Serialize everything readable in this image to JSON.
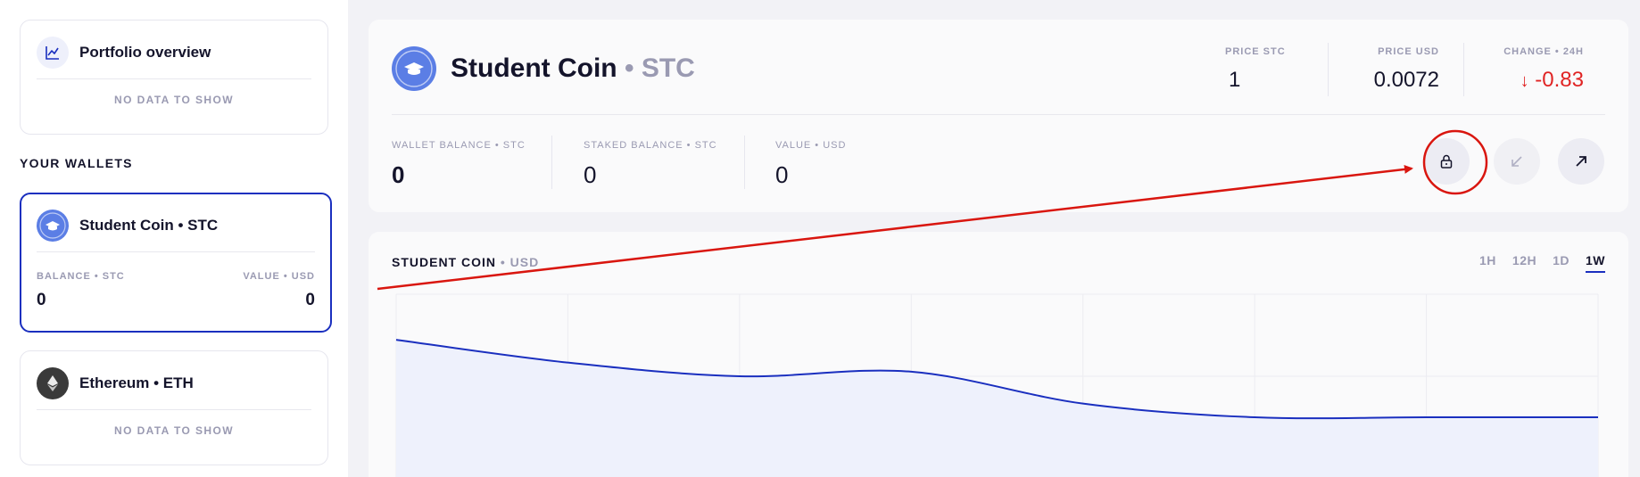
{
  "sidebar": {
    "portfolio": {
      "title": "Portfolio overview",
      "empty": "NO DATA TO SHOW"
    },
    "wallets_heading": "YOUR WALLETS",
    "wallets": [
      {
        "title": "Student Coin • STC",
        "balance_label": "BALANCE • STC",
        "value_label": "VALUE • USD",
        "balance": "0",
        "value": "0"
      },
      {
        "title": "Ethereum • ETH",
        "empty": "NO DATA TO SHOW"
      }
    ]
  },
  "coin": {
    "name": "Student Coin",
    "symbol": "• STC",
    "stats": [
      {
        "label": "PRICE STC",
        "value": "1"
      },
      {
        "label": "PRICE USD",
        "value": "0.0072"
      },
      {
        "label": "CHANGE • 24H",
        "value": "-0.83",
        "arrow": "↓"
      }
    ],
    "balances": [
      {
        "label": "WALLET BALANCE • STC",
        "value": "0"
      },
      {
        "label": "STAKED BALANCE • STC",
        "value": "0"
      },
      {
        "label": "VALUE • USD",
        "value": "0"
      }
    ],
    "actions": [
      "lock-icon",
      "arrow-down-left-icon",
      "arrow-up-right-icon"
    ]
  },
  "chart": {
    "title": "STUDENT COIN",
    "unit": "• USD",
    "tabs": [
      "1H",
      "12H",
      "1D",
      "1W"
    ],
    "active_tab": "1W"
  },
  "chart_data": {
    "type": "area",
    "title": "STUDENT COIN • USD",
    "x": [
      0,
      1,
      2,
      3,
      4,
      5,
      6,
      7
    ],
    "values": [
      1.0,
      0.9,
      0.84,
      0.86,
      0.72,
      0.66,
      0.66,
      0.66
    ],
    "grid": true,
    "series_color": "#1a2fbf"
  },
  "colors": {
    "accent": "#1a2fbf",
    "coin_icon": "#5b7ee5",
    "negative": "#e02424",
    "annotation": "#d9160f"
  }
}
